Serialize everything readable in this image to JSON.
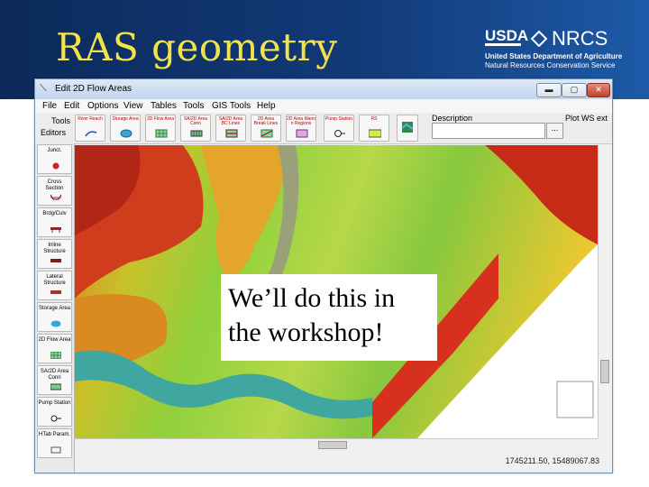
{
  "slide": {
    "title": "RAS geometry",
    "logo": {
      "usda": "USDA",
      "nrcs": "NRCS",
      "line1": "United States Department of Agriculture",
      "line2": "Natural Resources Conservation Service"
    },
    "callout": "We’ll do this in the workshop!"
  },
  "window": {
    "title": "Edit 2D Flow Areas",
    "controls": {
      "minimize": "▬",
      "maximize": "▢",
      "close": "✕"
    },
    "menu": [
      "File",
      "Edit",
      "Options",
      "View",
      "Tables",
      "Tools",
      "GIS Tools",
      "Help"
    ],
    "toolbar": {
      "buttons": [
        {
          "label": "River Reach",
          "icon": "river-reach-icon"
        },
        {
          "label": "Storage Area",
          "icon": "storage-area-icon"
        },
        {
          "label": "2D Flow Area",
          "icon": "2d-flow-area-icon"
        },
        {
          "label": "SA/2D Area Conn",
          "icon": "sa-2d-connection-icon"
        },
        {
          "label": "SA/2D Area BC Lines",
          "icon": "bc-lines-icon"
        },
        {
          "label": "2D Area Break Lines",
          "icon": "break-lines-icon"
        },
        {
          "label": "2D Area Mann n Regions",
          "icon": "mann-n-regions-icon"
        },
        {
          "label": "Pump Station",
          "icon": "pump-station-icon"
        },
        {
          "label": "RS",
          "icon": "river-station-icon"
        }
      ],
      "description_label": "Description",
      "description_button": "...",
      "plot_label": "Plot WS ext"
    },
    "tools_panel": {
      "header": "Tools",
      "header2": "Editors",
      "items": [
        {
          "label": "Junct.",
          "icon": "junction-icon"
        },
        {
          "label": "Cross Section",
          "icon": "cross-section-icon"
        },
        {
          "label": "Brdg/Culv",
          "icon": "bridge-culvert-icon"
        },
        {
          "label": "Inline Structure",
          "icon": "inline-structure-icon"
        },
        {
          "label": "Lateral Structure",
          "icon": "lateral-structure-icon"
        },
        {
          "label": "Storage Area",
          "icon": "storage-area-icon"
        },
        {
          "label": "2D Flow Area",
          "icon": "2d-flow-area-icon"
        },
        {
          "label": "SA/2D Area Conn",
          "icon": "sa-2d-connection-icon"
        },
        {
          "label": "Pump Station",
          "icon": "pump-station-icon"
        },
        {
          "label": "HTab Param.",
          "icon": "htab-param-icon"
        }
      ]
    },
    "status": {
      "coords": "1745211.50, 15489067.83"
    }
  }
}
